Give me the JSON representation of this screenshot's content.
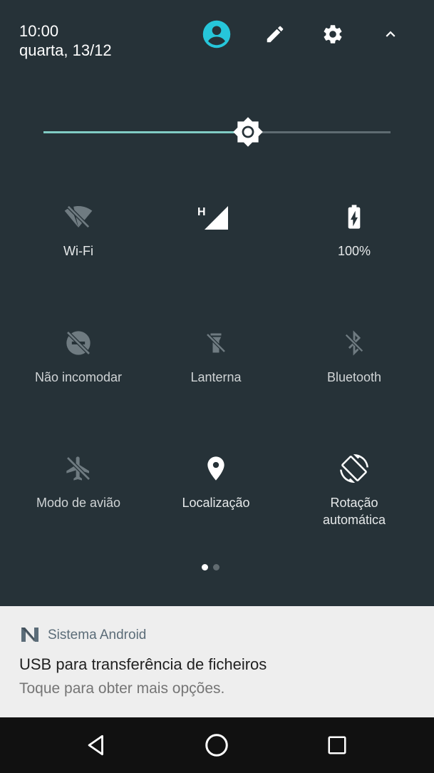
{
  "status": {
    "time": "10:00",
    "date": "quarta, 13/12"
  },
  "header_icons": {
    "user": "account-circle-icon",
    "edit": "pencil-icon",
    "settings": "gear-icon",
    "collapse": "chevron-up-icon"
  },
  "brightness": {
    "level": 0.59,
    "icon": "brightness-icon"
  },
  "tiles": [
    {
      "label": "Wi-Fi",
      "icon": "wifi-off-icon",
      "active": false
    },
    {
      "label": "",
      "icon": "cellular-signal-icon",
      "badge": "H",
      "active": true
    },
    {
      "label": "100%",
      "icon": "battery-charging-icon",
      "active": true
    },
    {
      "label": "Não incomodar",
      "icon": "do-not-disturb-off-icon",
      "active": false
    },
    {
      "label": "Lanterna",
      "icon": "flashlight-off-icon",
      "active": false
    },
    {
      "label": "Bluetooth",
      "icon": "bluetooth-off-icon",
      "active": false
    },
    {
      "label": "Modo de avião",
      "icon": "airplane-off-icon",
      "active": false
    },
    {
      "label": "Localização",
      "icon": "location-pin-icon",
      "active": true
    },
    {
      "label": "Rotação\nautomática",
      "icon": "screen-rotation-icon",
      "active": true
    }
  ],
  "pager": {
    "pages": 2,
    "current": 1
  },
  "notification": {
    "app": "Sistema Android",
    "title": "USB para transferência de ficheiros",
    "text": "Toque para obter mais opções."
  },
  "navbar": {
    "back": "back-icon",
    "home": "home-icon",
    "recents": "recents-icon"
  },
  "colors": {
    "panel": "#263238",
    "accent": "#80cbc4",
    "user_icon": "#26c6da",
    "notification_bg": "#eeeeee"
  }
}
